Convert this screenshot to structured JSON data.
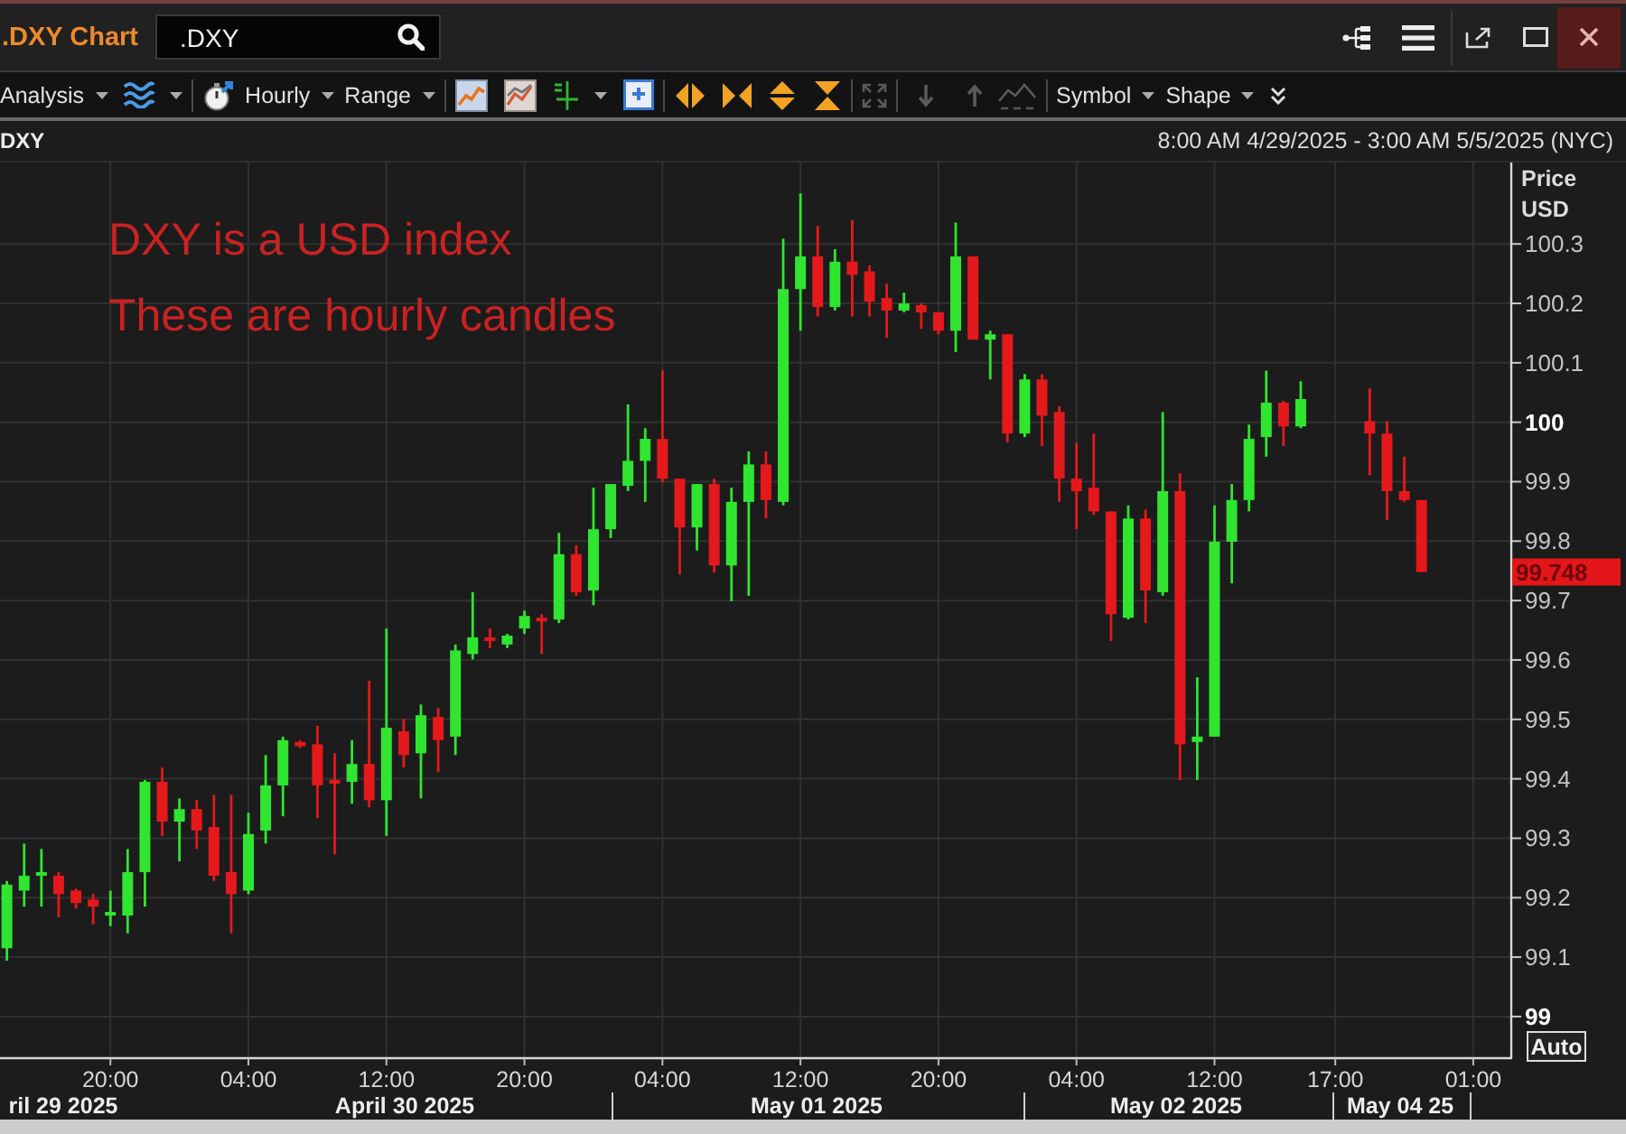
{
  "window": {
    "title": ".DXY Chart",
    "search": {
      "value": ".DXY"
    }
  },
  "toolbar": {
    "analysis": "Analysis",
    "interval": "Hourly",
    "range": "Range",
    "symbol": "Symbol",
    "shape": "Shape",
    "view_tools": {
      "disabled": true
    }
  },
  "chart_header": {
    "symbol": "DXY",
    "date_range": "8:00 AM 4/29/2025 - 3:00 AM 5/5/2025 (NYC)"
  },
  "chart": {
    "annotation_lines": [
      "DXY is a USD index",
      "These are hourly candles"
    ],
    "chart_data": {
      "type": "candlestick",
      "categories": [
        null,
        null,
        null,
        null,
        null,
        null,
        "20:00",
        null,
        null,
        null,
        null,
        null,
        null,
        null,
        "04:00",
        null,
        null,
        null,
        null,
        null,
        null,
        null,
        "12:00",
        null,
        null,
        null,
        null,
        null,
        null,
        null,
        "20:00",
        null,
        null,
        null,
        null,
        null,
        null,
        null,
        "04:00",
        null,
        null,
        null,
        null,
        null,
        null,
        null,
        "12:00",
        null,
        null,
        null,
        null,
        null,
        null,
        null,
        "20:00",
        null,
        null,
        null,
        null,
        null,
        null,
        null,
        "04:00",
        null,
        null,
        null,
        null,
        null,
        null,
        null,
        "12:00",
        null,
        null,
        null,
        null,
        null,
        null,
        "17:00",
        null,
        null,
        null,
        null,
        null,
        null,
        null,
        "01:00"
      ],
      "ohlc": [
        [
          99.115,
          99.228,
          99.094,
          99.222
        ],
        [
          99.212,
          99.291,
          99.185,
          99.237
        ],
        [
          99.237,
          99.282,
          99.185,
          99.243
        ],
        [
          99.237,
          99.243,
          99.167,
          99.206
        ],
        [
          99.212,
          99.215,
          99.182,
          99.191
        ],
        [
          99.197,
          99.206,
          99.155,
          99.185
        ],
        [
          99.17,
          99.212,
          99.152,
          99.176
        ],
        [
          99.17,
          99.282,
          99.14,
          99.243
        ],
        [
          99.243,
          99.398,
          99.185,
          99.395
        ],
        [
          99.395,
          99.419,
          99.304,
          99.328
        ],
        [
          99.328,
          99.367,
          99.261,
          99.349
        ],
        [
          99.349,
          99.364,
          99.282,
          99.313
        ],
        [
          99.319,
          99.373,
          99.228,
          99.237
        ],
        [
          99.243,
          99.373,
          99.14,
          99.206
        ],
        [
          99.212,
          99.343,
          99.206,
          99.307
        ],
        [
          99.313,
          99.44,
          99.291,
          99.389
        ],
        [
          99.389,
          99.471,
          99.337,
          99.465
        ],
        [
          99.462,
          99.465,
          99.452,
          99.455
        ],
        [
          99.458,
          99.489,
          99.334,
          99.389
        ],
        [
          99.398,
          99.443,
          99.273,
          99.392
        ],
        [
          99.395,
          99.465,
          99.358,
          99.425
        ],
        [
          99.425,
          99.565,
          99.352,
          99.364
        ],
        [
          99.364,
          99.653,
          99.304,
          99.486
        ],
        [
          99.48,
          99.501,
          99.419,
          99.44
        ],
        [
          99.443,
          99.525,
          99.367,
          99.507
        ],
        [
          99.504,
          99.519,
          99.411,
          99.465
        ],
        [
          99.471,
          99.626,
          99.44,
          99.616
        ],
        [
          99.61,
          99.714,
          99.601,
          99.638
        ],
        [
          99.638,
          99.653,
          99.62,
          99.632
        ],
        [
          99.626,
          99.644,
          99.62,
          99.641
        ],
        [
          99.653,
          99.683,
          99.644,
          99.674
        ],
        [
          99.671,
          99.677,
          99.61,
          99.665
        ],
        [
          99.668,
          99.814,
          99.662,
          99.778
        ],
        [
          99.778,
          99.793,
          99.708,
          99.714
        ],
        [
          99.717,
          99.89,
          99.692,
          99.82
        ],
        [
          99.82,
          99.896,
          99.805,
          99.896
        ],
        [
          99.893,
          100.03,
          99.884,
          99.935
        ],
        [
          99.935,
          99.99,
          99.866,
          99.972
        ],
        [
          99.972,
          100.087,
          99.899,
          99.905
        ],
        [
          99.905,
          99.905,
          99.744,
          99.823
        ],
        [
          99.823,
          99.896,
          99.784,
          99.896
        ],
        [
          99.896,
          99.905,
          99.747,
          99.759
        ],
        [
          99.759,
          99.89,
          99.699,
          99.866
        ],
        [
          99.866,
          99.951,
          99.708,
          99.929
        ],
        [
          99.929,
          99.951,
          99.838,
          99.869
        ],
        [
          99.866,
          100.309,
          99.86,
          100.224
        ],
        [
          100.224,
          100.385,
          100.154,
          100.279
        ],
        [
          100.279,
          100.33,
          100.178,
          100.194
        ],
        [
          100.194,
          100.291,
          100.188,
          100.27
        ],
        [
          100.27,
          100.34,
          100.178,
          100.248
        ],
        [
          100.254,
          100.264,
          100.178,
          100.203
        ],
        [
          100.209,
          100.233,
          100.142,
          100.188
        ],
        [
          100.188,
          100.218,
          100.185,
          100.2
        ],
        [
          100.197,
          100.2,
          100.157,
          100.185
        ],
        [
          100.185,
          100.185,
          100.148,
          100.154
        ],
        [
          100.154,
          100.336,
          100.118,
          100.279
        ],
        [
          100.279,
          100.279,
          100.139,
          100.139
        ],
        [
          100.139,
          100.154,
          100.072,
          100.148
        ],
        [
          100.148,
          100.148,
          99.966,
          99.981
        ],
        [
          99.981,
          100.081,
          99.975,
          100.072
        ],
        [
          100.072,
          100.081,
          99.96,
          100.011
        ],
        [
          100.017,
          100.027,
          99.866,
          99.905
        ],
        [
          99.905,
          99.966,
          99.82,
          99.884
        ],
        [
          99.89,
          99.981,
          99.844,
          99.85
        ],
        [
          99.85,
          99.85,
          99.632,
          99.677
        ],
        [
          99.671,
          99.86,
          99.668,
          99.838
        ],
        [
          99.838,
          99.853,
          99.662,
          99.717
        ],
        [
          99.714,
          100.017,
          99.708,
          99.884
        ],
        [
          99.884,
          99.914,
          99.398,
          99.458
        ],
        [
          99.462,
          99.571,
          99.398,
          99.471
        ],
        [
          99.471,
          99.86,
          99.471,
          99.799
        ],
        [
          99.799,
          99.896,
          99.729,
          99.869
        ],
        [
          99.869,
          99.996,
          99.85,
          99.972
        ],
        [
          99.975,
          100.087,
          99.942,
          100.033
        ],
        [
          100.033,
          100.036,
          99.96,
          99.993
        ],
        [
          99.993,
          100.069,
          99.99,
          100.039
        ],
        null,
        null,
        null,
        [
          100.002,
          100.057,
          99.911,
          99.981
        ],
        [
          99.981,
          100.002,
          99.835,
          99.884
        ],
        [
          99.884,
          99.942,
          99.866,
          99.869
        ],
        [
          99.869,
          99.869,
          99.748,
          99.748
        ],
        null,
        null,
        null
      ],
      "ylim": [
        98.93,
        100.437
      ],
      "yticks": [
        100.3,
        100.2,
        100.1,
        100,
        99.9,
        99.8,
        99.7,
        99.6,
        99.5,
        99.4,
        99.3,
        99.2,
        99.1,
        99
      ],
      "grid": true
    },
    "price_axis": {
      "title": "Price",
      "unit": "USD",
      "last_price": "99.748",
      "scale_button": "Auto"
    },
    "date_labels": [
      "ril 29 2025",
      "April 30 2025",
      "May 01 2025",
      "May 02 2025",
      "May 04 25"
    ]
  }
}
